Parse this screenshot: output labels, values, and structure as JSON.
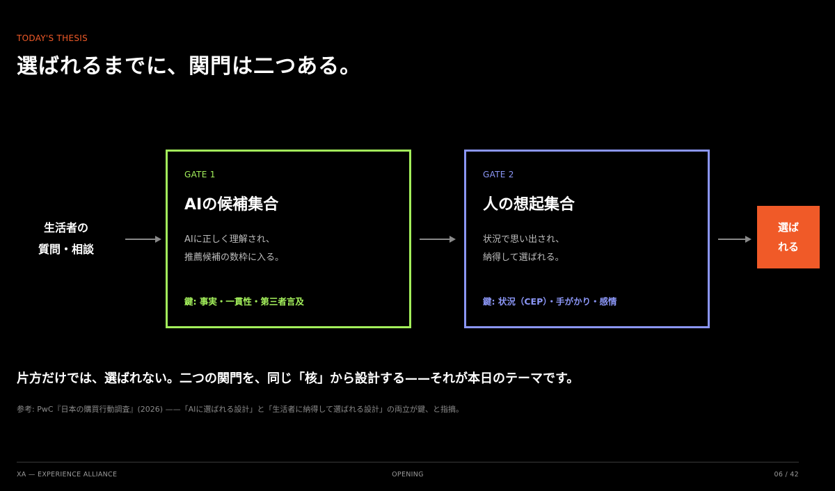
{
  "header": {
    "eyebrow": "TODAY'S THESIS",
    "title": "選ばれるまでに、関門は二つある。"
  },
  "flow": {
    "source_line1": "生活者の",
    "source_line2": "質問・相談",
    "gate1": {
      "tag": "GATE 1",
      "title": "AIの候補集合",
      "desc_line1": "AIに正しく理解され、",
      "desc_line2": "推薦候補の数枠に入る。",
      "key": "鍵: 事実・一貫性・第三者言及",
      "color": "#a3ef5b"
    },
    "gate2": {
      "tag": "GATE 2",
      "title": "人の想起集合",
      "desc_line1": "状況で思い出され、",
      "desc_line2": "納得して選ばれる。",
      "key": "鍵: 状況（CEP）・手がかり・感情",
      "color": "#8b96f6"
    },
    "result": {
      "line1": "選ば",
      "line2": "れる",
      "color": "#f05a28"
    }
  },
  "statement": "片方だけでは、選ばれない。二つの関門を、同じ「核」から設計する——それが本日のテーマです。",
  "reference": "参考: PwC『日本の購買行動調査』(2026) ——「AIに選ばれる設計」と「生活者に納得して選ばれる設計」の両立が鍵、と指摘。",
  "footer": {
    "left": "XA — EXPERIENCE ALLIANCE",
    "center": "OPENING",
    "right": "06 / 42"
  }
}
